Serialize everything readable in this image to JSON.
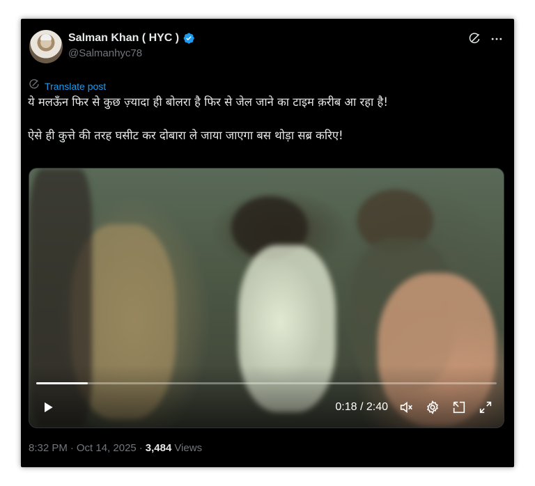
{
  "post": {
    "author_name": "Salman Khan ( HYC )",
    "author_handle": "@Salmanhyc78",
    "translate_label": "Translate post",
    "text_line_1": "ये मलऊँन फिर से कुछ ज़्यादा ही बोलरा है फिर से जेल जाने का टाइम क़रीब आ रहा है!",
    "text_line_2": "ऐसे ही कुत्ते की तरह घसीट कर दोबारा ले जाया जाएगा बस थोड़ा सब्र करिए!",
    "time": "8:32 PM",
    "date": "Oct 14, 2025",
    "separator": "·",
    "views_count": "3,484",
    "views_label": "Views"
  },
  "video": {
    "current_time": "0:18",
    "duration": "2:40",
    "time_display": "0:18 / 2:40",
    "progress_fraction": 0.1125
  },
  "icons": {
    "verified": "verified-badge-icon",
    "grok": "grok-icon",
    "more": "more-icon",
    "translate": "globe-icon",
    "play": "play-icon",
    "volume": "volume-icon",
    "settings": "settings-gear-icon",
    "pip": "picture-in-picture-icon",
    "fullscreen": "fullscreen-icon"
  },
  "colors": {
    "background": "#000000",
    "text": "#e7e9ea",
    "muted": "#71767b",
    "accent": "#1d9bf0"
  }
}
